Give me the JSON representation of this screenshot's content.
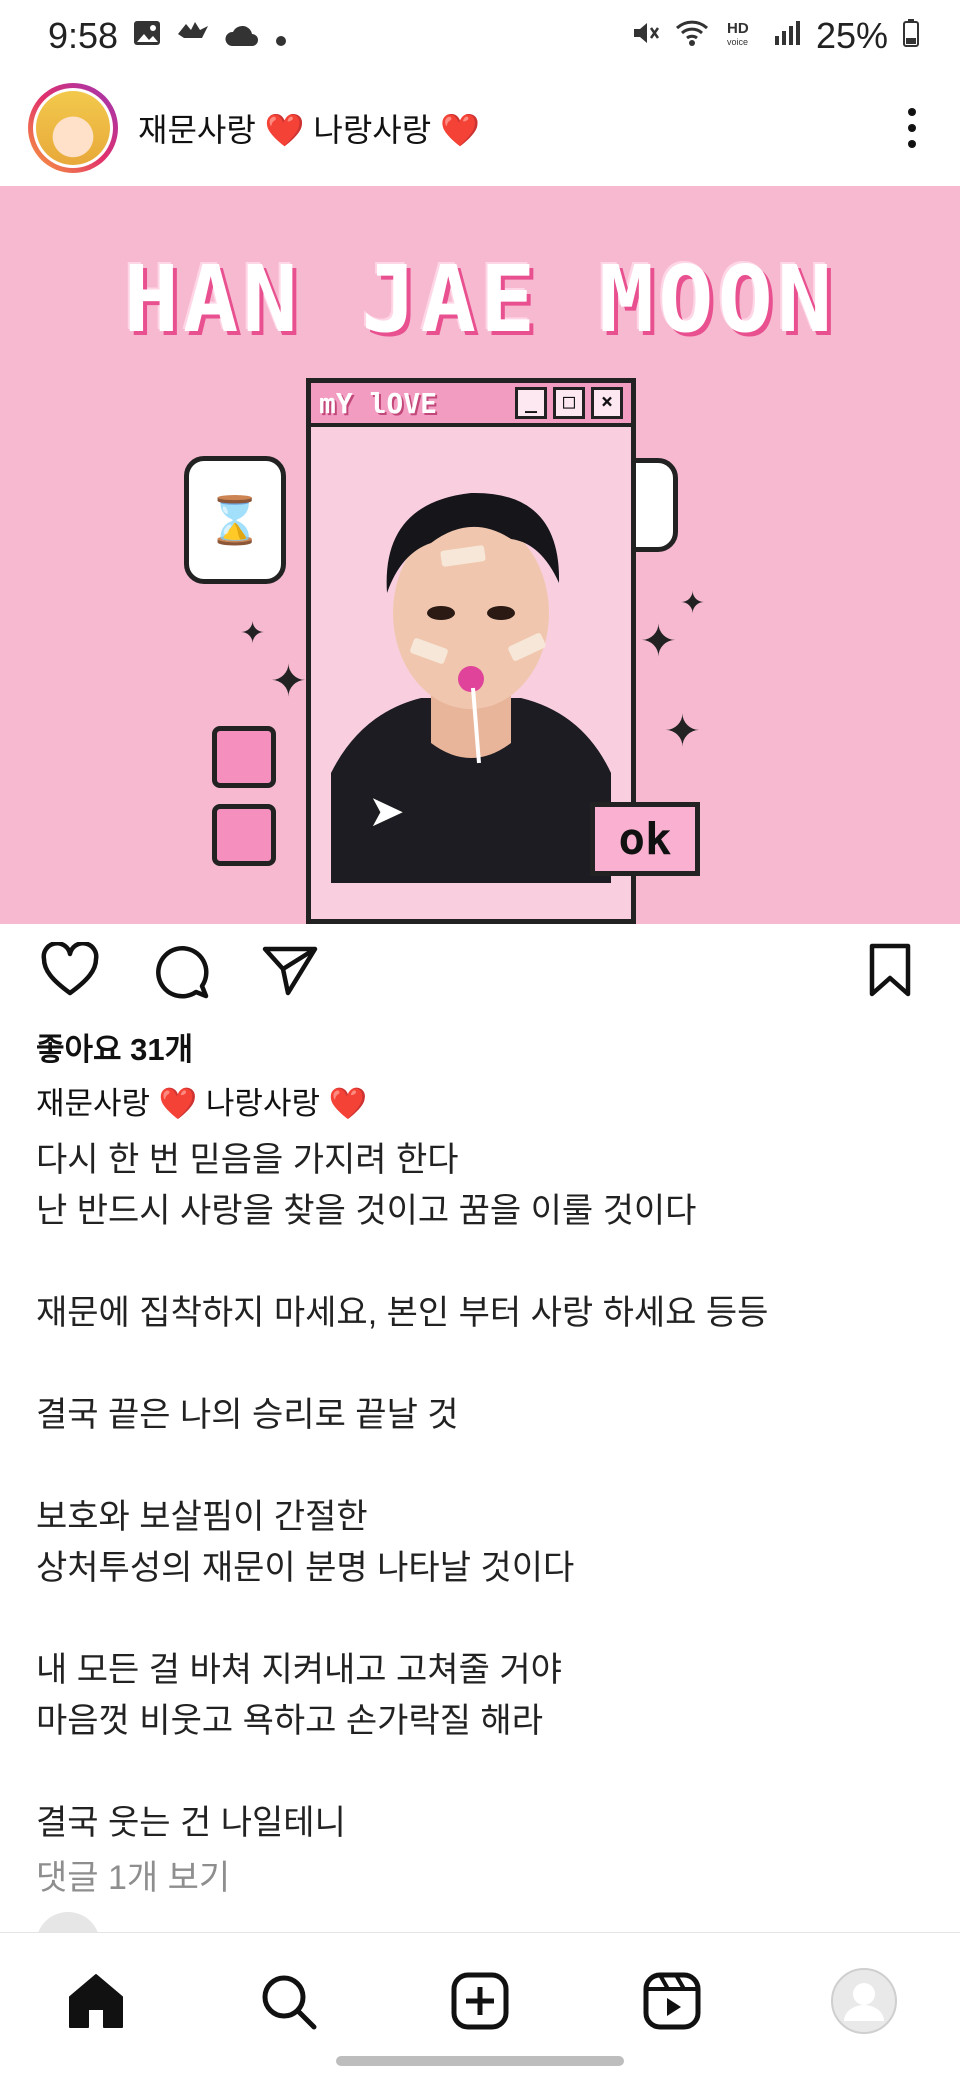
{
  "status_bar": {
    "time": "9:58",
    "battery": "25%",
    "left_icons": [
      "image-icon",
      "bird-icon",
      "cloud-icon",
      "dot-icon"
    ],
    "right_icons": [
      "mute-icon",
      "wifi-icon",
      "hd-voice-icon",
      "signal-icon",
      "battery-icon"
    ]
  },
  "post": {
    "username": "재문사랑 ❤️ 나랑사랑 ❤️",
    "image": {
      "title_text": "HAN JAE MOON",
      "window_title": "mY lOVE",
      "ok_label": "ok"
    },
    "likes": "좋아요 31개",
    "caption_user": "재문사랑 ❤️ 나랑사랑 ❤️",
    "caption_lines": [
      "다시 한 번 믿음을 가지려 한다",
      "난 반드시 사랑을 찾을 것이고 꿈을 이룰 것이다",
      "",
      "재문에 집착하지 마세요, 본인 부터 사랑 하세요 등등",
      "",
      "결국 끝은 나의 승리로 끝날 것",
      "",
      "보호와 보살핌이 간절한",
      "상처투성의 재문이 분명 나타날 것이다",
      "",
      "내 모든 걸 바쳐 지켜내고 고쳐줄 거야",
      "마음껏 비웃고 욕하고 손가락질 해라",
      "",
      "결국 웃는 건 나일테니"
    ],
    "comments_link": "댓글 1개 보기"
  },
  "nav": {
    "items": [
      "home-icon",
      "search-icon",
      "create-icon",
      "reels-icon",
      "profile-icon"
    ]
  },
  "colors": {
    "image_bg": "#f6b9cf",
    "accent_pink": "#e8508f",
    "muted": "#8e8e8e"
  }
}
